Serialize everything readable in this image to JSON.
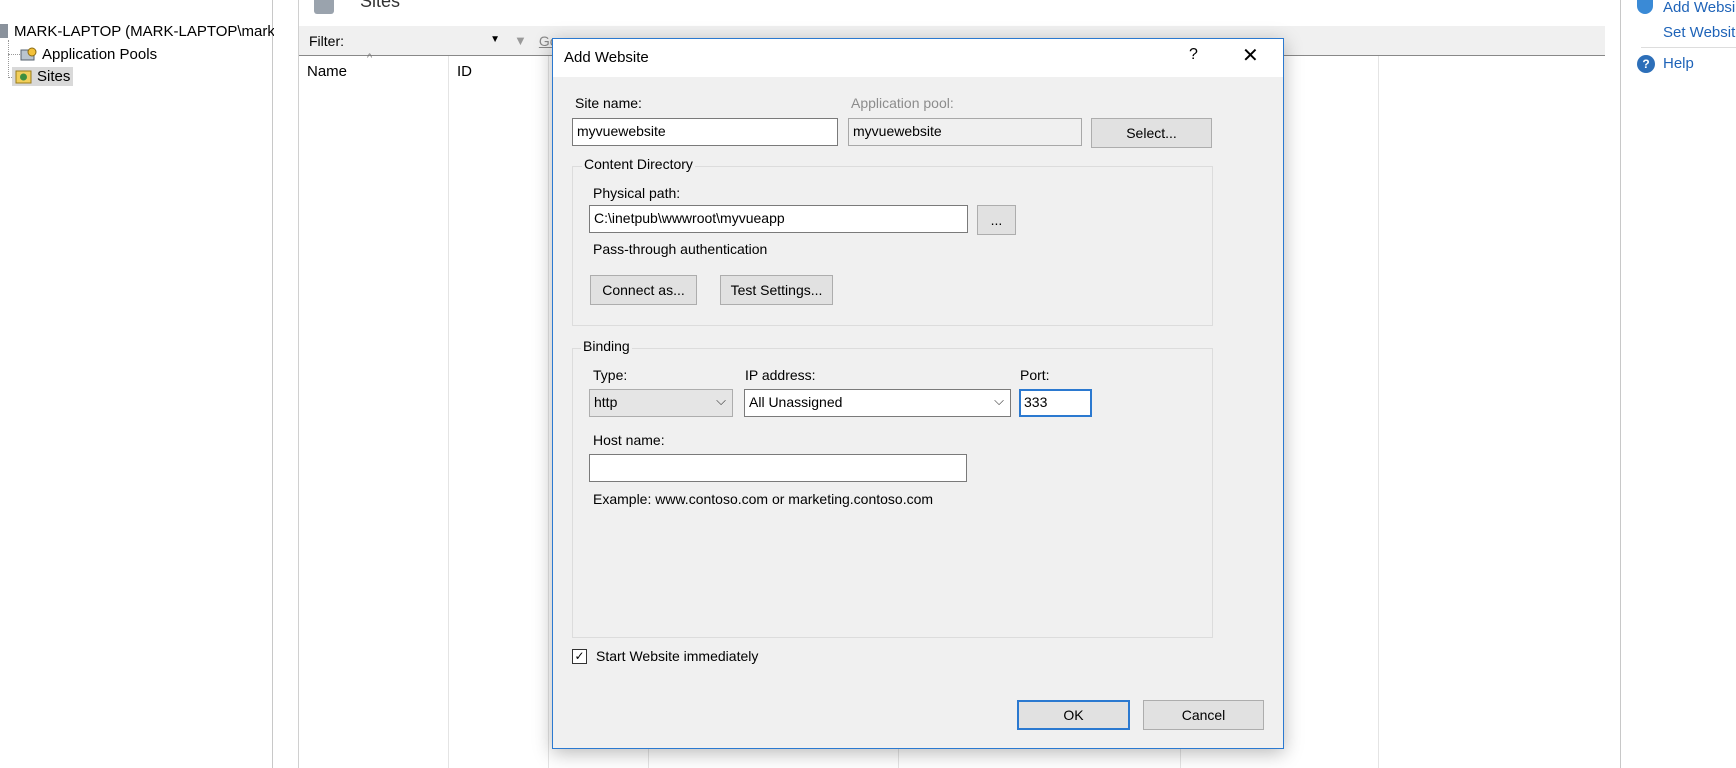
{
  "tree": {
    "server": "MARK-LAPTOP (MARK-LAPTOP\\marko",
    "app_pools": "Application Pools",
    "sites": "Sites"
  },
  "center": {
    "header_title": "Sites",
    "filter_label": "Filter:",
    "go_label": "Go",
    "columns": [
      "Name",
      "ID"
    ]
  },
  "actions": {
    "add_website": "Add Websi",
    "set_website_defaults": "Set Website",
    "help": "Help"
  },
  "dialog": {
    "title": "Add Website",
    "help_glyph": "?",
    "close_glyph": "✕",
    "site_name_label": "Site name:",
    "site_name_value": "myvuewebsite",
    "app_pool_label": "Application pool:",
    "app_pool_value": "myvuewebsite",
    "select_button": "Select...",
    "content_directory": {
      "title": "Content Directory",
      "physical_path_label": "Physical path:",
      "physical_path_value": "C:\\inetpub\\wwwroot\\myvueapp",
      "browse_button": "...",
      "auth_text": "Pass-through authentication",
      "connect_as_button": "Connect as...",
      "test_settings_button": "Test Settings..."
    },
    "binding": {
      "title": "Binding",
      "type_label": "Type:",
      "type_value": "http",
      "ip_label": "IP address:",
      "ip_value": "All Unassigned",
      "port_label": "Port:",
      "port_value": "333",
      "host_name_label": "Host name:",
      "host_name_value": "",
      "example_text": "Example: www.contoso.com or marketing.contoso.com"
    },
    "start_immediately_label": "Start Website immediately",
    "start_immediately_checked": true,
    "ok_button": "OK",
    "cancel_button": "Cancel"
  },
  "colors": {
    "accent": "#2b79d0",
    "link": "#1e63b8",
    "dialog_bg": "#f0f0f0"
  }
}
